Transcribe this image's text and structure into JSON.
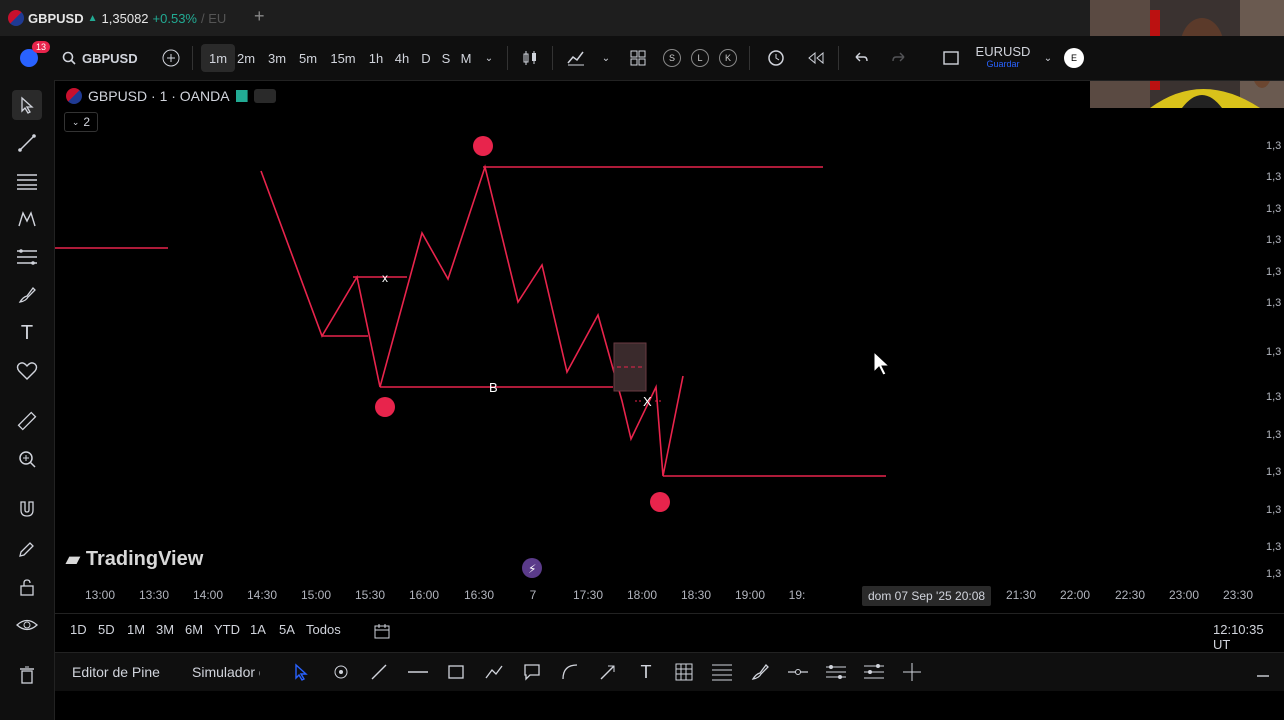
{
  "tab": {
    "symbol": "GBPUSD",
    "price": "1,35082",
    "change": "+0.53%",
    "extra": "/ EU"
  },
  "toolbar": {
    "notif_count": "13",
    "symbol": "GBPUSD",
    "timeframes": [
      "1m",
      "2m",
      "3m",
      "5m",
      "15m",
      "1h",
      "4h",
      "D",
      "S",
      "M"
    ],
    "active_timeframe": "1m",
    "letters": [
      "S",
      "L",
      "K"
    ],
    "right_symbol": "EURUSD",
    "save_label": "Guardar",
    "avatar": "E"
  },
  "chart": {
    "title": "GBPUSD · 1 · OANDA",
    "indicator_count": "2",
    "watermark": "TradingView",
    "labels": {
      "x1": "x",
      "b": "B",
      "x2": "X"
    },
    "line_color": "#e8244c",
    "x_ticks": [
      "13:00",
      "13:30",
      "14:00",
      "14:30",
      "15:00",
      "15:30",
      "16:00",
      "16:30",
      "7",
      "17:30",
      "18:00",
      "18:30",
      "19:00",
      "19:",
      "21:00",
      "21:30",
      "22:00",
      "22:30",
      "23:00",
      "23:30"
    ],
    "crosshair_time": "dom 07 Sep '25   20:08",
    "y_ticks": [
      "1,3",
      "1,3",
      "1,3",
      "1,3",
      "1,3",
      "1,3",
      "1,3",
      "1,3",
      "1,3",
      "1,3",
      "1,3",
      "1,3",
      "1,3"
    ]
  },
  "ranges": {
    "items": [
      "1D",
      "5D",
      "1M",
      "3M",
      "6M",
      "YTD",
      "1A",
      "5A",
      "Todos"
    ],
    "clock": "12:10:35 UT"
  },
  "panel": {
    "pine": "Editor de Pine",
    "simulator": "Simulador de"
  }
}
